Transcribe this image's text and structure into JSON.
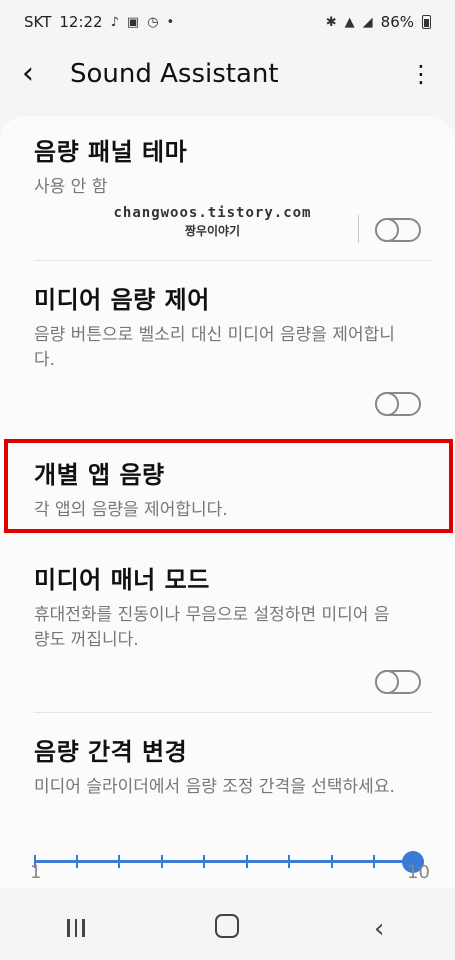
{
  "status_bar": {
    "carrier": "SKT",
    "time": "12:22",
    "dot": "•",
    "battery": "86%"
  },
  "app_bar": {
    "title": "Sound Assistant"
  },
  "items": [
    {
      "title": "음량 패널 테마",
      "subtitle": "사용 안 함"
    },
    {
      "title": "미디어 음량 제어",
      "subtitle": "음량 버튼으로 벨소리 대신 미디어 음량을 제어합니다."
    },
    {
      "title": "개별 앱 음량",
      "subtitle": "각 앱의 음량을 제어합니다."
    },
    {
      "title": "미디어 매너 모드",
      "subtitle": "휴대전화를 진동이나 무음으로 설정하면 미디어 음량도 꺼집니다."
    },
    {
      "title": "음량 간격 변경",
      "subtitle": "미디어 슬라이더에서 음량 조정 간격을 선택하세요."
    }
  ],
  "watermark": {
    "line1": "changwoos.tistory.com",
    "line2": "짱우이야기"
  },
  "slider": {
    "min_label": "1",
    "max_label": "10",
    "value": 10
  },
  "colors": {
    "accent": "#3a7bd5",
    "highlight": "#e10000"
  }
}
